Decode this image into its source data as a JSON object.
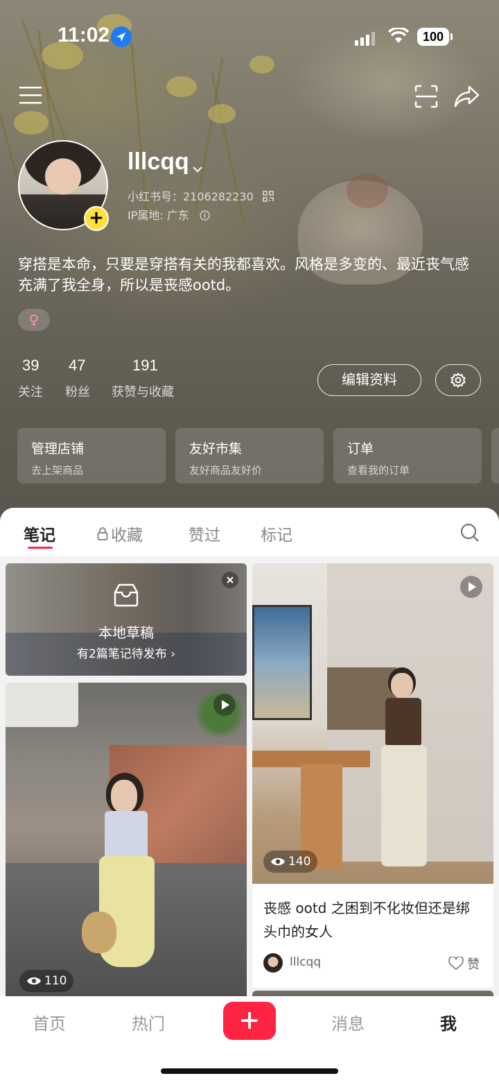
{
  "status": {
    "time": "11:02",
    "battery": "100"
  },
  "profile": {
    "username": "lllcqq",
    "id_label": "小红书号：2106282230",
    "ip_label": "IP属地: 广东",
    "bio": "穿搭是本命，只要是穿搭有关的我都喜欢。风格是多变的、最近丧气感充满了我全身，所以是丧感ootd。",
    "gender_symbol": "♀",
    "stats": [
      {
        "value": "39",
        "label": "关注"
      },
      {
        "value": "47",
        "label": "粉丝"
      },
      {
        "value": "191",
        "label": "获赞与收藏"
      }
    ],
    "edit_label": "编辑资料"
  },
  "shortcuts": [
    {
      "title": "管理店铺",
      "subtitle": "去上架商品"
    },
    {
      "title": "友好市集",
      "subtitle": "友好商品友好价"
    },
    {
      "title": "订单",
      "subtitle": "查看我的订单"
    }
  ],
  "tabs": [
    {
      "label": "笔记",
      "active": true
    },
    {
      "label": "收藏",
      "locked": true
    },
    {
      "label": "赞过"
    },
    {
      "label": "标记"
    }
  ],
  "drafts": {
    "title": "本地草稿",
    "subtitle": "有2篇笔记待发布 ›"
  },
  "posts": [
    {
      "views": "110",
      "video": true
    },
    {
      "views": "140",
      "video": true,
      "title": "丧感 ootd 之困到不化妆但还是绑头巾的女人",
      "author": "lllcqq",
      "like_label": "赞"
    }
  ],
  "nav": [
    {
      "label": "首页"
    },
    {
      "label": "热门"
    },
    {
      "label": "消息"
    },
    {
      "label": "我",
      "active": true
    }
  ],
  "colors": {
    "accent": "#ff2442",
    "plus_badge": "#ffe03d"
  }
}
